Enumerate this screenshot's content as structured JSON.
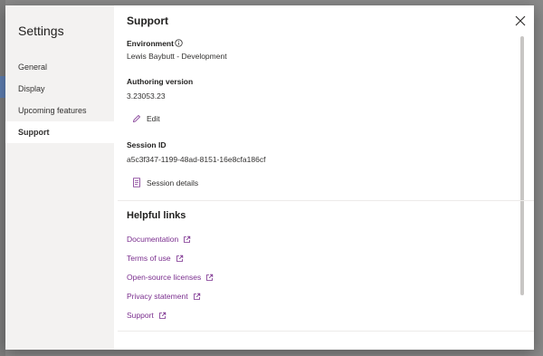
{
  "backdrop": {
    "accent_color": "#5f7fb3"
  },
  "sidebar": {
    "title": "Settings",
    "items": [
      {
        "label": "General",
        "active": false
      },
      {
        "label": "Display",
        "active": false
      },
      {
        "label": "Upcoming features",
        "active": false
      },
      {
        "label": "Support",
        "active": true
      }
    ]
  },
  "panel": {
    "title": "Support",
    "close_icon": "close-icon",
    "environment": {
      "label": "Environment",
      "icon": "info-icon",
      "value": "Lewis Baybutt - Development"
    },
    "authoring_version": {
      "label": "Authoring version",
      "value": "3.23053.23",
      "edit_label": "Edit",
      "edit_icon": "pencil-icon"
    },
    "session": {
      "label": "Session ID",
      "value": "a5c3f347-1199-48ad-8151-16e8cfa186cf",
      "details_label": "Session details",
      "details_icon": "document-icon"
    },
    "helpful_links": {
      "title": "Helpful links",
      "link_color": "#7a2e8e",
      "external_icon": "external-link-icon",
      "items": [
        {
          "label": "Documentation"
        },
        {
          "label": "Terms of use"
        },
        {
          "label": "Open-source licenses"
        },
        {
          "label": "Privacy statement"
        },
        {
          "label": "Support"
        }
      ]
    }
  }
}
